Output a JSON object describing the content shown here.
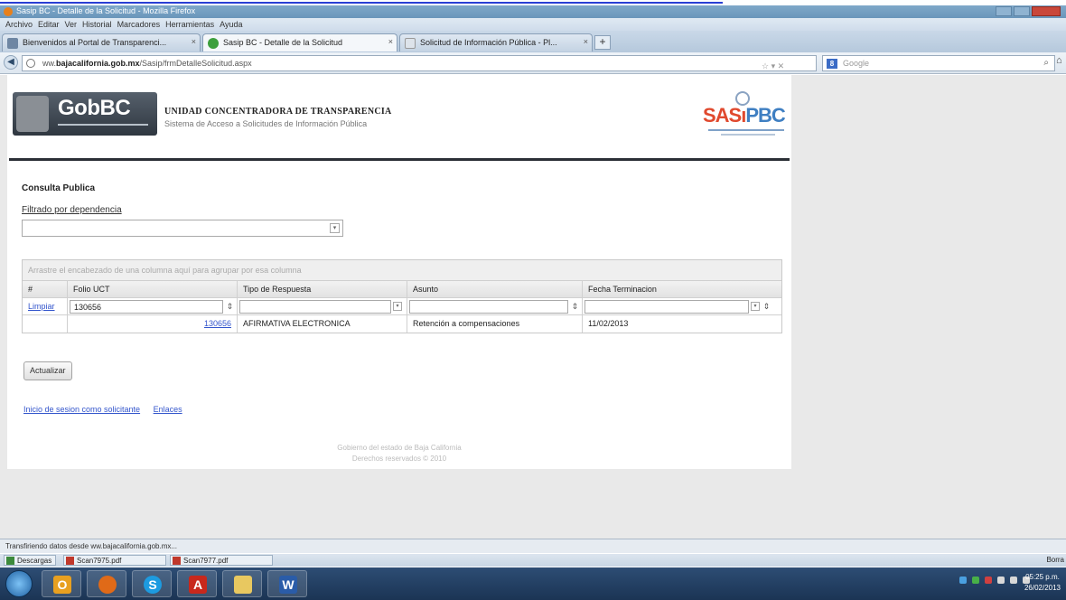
{
  "browser": {
    "window_title": "Sasip BC - Detalle de la Solicitud - Mozilla Firefox",
    "menu": [
      "Archivo",
      "Editar",
      "Ver",
      "Historial",
      "Marcadores",
      "Herramientas",
      "Ayuda"
    ],
    "tabs": [
      {
        "label": "Bienvenidos al Portal de Transparenci...",
        "active": false
      },
      {
        "label": "Sasip BC - Detalle de la Solicitud",
        "active": true
      },
      {
        "label": "Solicitud de Información Pública - Pl...",
        "active": false
      }
    ],
    "url_prefix": "ww.",
    "url_host": "bajacalifornia.gob.mx",
    "url_path": "/Sasip/frmDetalleSolicitud.aspx",
    "search_placeholder": "Google",
    "status_text": "Transfiriendo datos desde ww.bajacalifornia.gob.mx...",
    "downloads": [
      {
        "label": "Descargas"
      },
      {
        "label": "Scan7975.pdf"
      },
      {
        "label": "Scan7977.pdf"
      }
    ],
    "downloads_right": "Borra"
  },
  "header": {
    "logo_text": "GobBC",
    "title": "UNIDAD CONCENTRADORA DE TRANSPARENCIA",
    "subtitle": "Sistema de Acceso a Solicitudes de Información Pública",
    "right_logo_part1": "SAS",
    "right_logo_part2": "PBC"
  },
  "main": {
    "section_title": "Consulta Publica",
    "filter_label": "Filtrado por dependencia",
    "filter_value": "",
    "grid": {
      "group_hint": "Arrastre el encabezado de una columna aquí para agrupar por esa columna",
      "columns": [
        "#",
        "Folio UCT",
        "Tipo de Respuesta",
        "Asunto",
        "Fecha Terminacion"
      ],
      "filter_row": {
        "clear_link": "Limpiar",
        "folio_value": "130656"
      },
      "rows": [
        {
          "folio": "130656",
          "tipo": "AFIRMATIVA ELECTRONICA",
          "asunto": "Retención a compensaciones",
          "fecha": "11/02/2013"
        }
      ]
    },
    "update_button": "Actualizar",
    "links": [
      "Inicio de sesion como solicitante",
      "Enlaces"
    ],
    "footer_line1": "Gobierno del estado de Baja California",
    "footer_line2": "Derechos reservados © 2010"
  },
  "taskbar": {
    "clock_time": "05:25 p.m.",
    "clock_date": "26/02/2013"
  }
}
